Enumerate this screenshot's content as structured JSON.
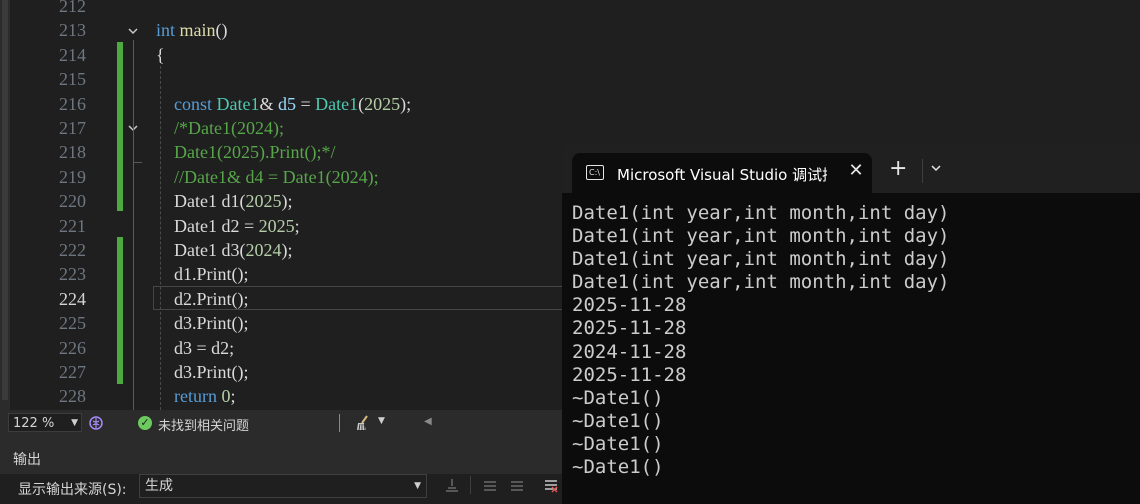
{
  "editor": {
    "lines": [
      {
        "n": "212",
        "current": false,
        "segments": []
      },
      {
        "n": "213",
        "current": false,
        "segments": [
          {
            "t": "int ",
            "c": "kw"
          },
          {
            "t": "main",
            "c": "fn"
          },
          {
            "t": "()",
            "c": "pl"
          }
        ]
      },
      {
        "n": "214",
        "current": false,
        "segments": [
          {
            "t": "{",
            "c": "pl"
          }
        ]
      },
      {
        "n": "215",
        "current": false,
        "segments": []
      },
      {
        "n": "216",
        "current": false,
        "segments": [
          {
            "t": "    "
          },
          {
            "t": "const ",
            "c": "kw"
          },
          {
            "t": "Date1",
            "c": "ty"
          },
          {
            "t": "& ",
            "c": "pl"
          },
          {
            "t": "d5",
            "c": "var"
          },
          {
            "t": " = ",
            "c": "pl"
          },
          {
            "t": "Date1",
            "c": "ty"
          },
          {
            "t": "(",
            "c": "pl"
          },
          {
            "t": "2025",
            "c": "num"
          },
          {
            "t": ");",
            "c": "pl"
          }
        ]
      },
      {
        "n": "217",
        "current": false,
        "segments": [
          {
            "t": "    "
          },
          {
            "t": "/*Date1(2024);",
            "c": "cm"
          }
        ]
      },
      {
        "n": "218",
        "current": false,
        "segments": [
          {
            "t": "    "
          },
          {
            "t": "Date1(2025).Print();*/",
            "c": "cm"
          }
        ]
      },
      {
        "n": "219",
        "current": false,
        "segments": [
          {
            "t": "    "
          },
          {
            "t": "//Date1& d4 = Date1(2024);",
            "c": "cm"
          }
        ]
      },
      {
        "n": "220",
        "current": false,
        "segments": [
          {
            "t": "    "
          },
          {
            "t": "Date1",
            "c": "pl"
          },
          {
            "t": " d1(",
            "c": "pl"
          },
          {
            "t": "2025",
            "c": "num"
          },
          {
            "t": ");",
            "c": "pl"
          }
        ]
      },
      {
        "n": "221",
        "current": false,
        "segments": [
          {
            "t": "    "
          },
          {
            "t": "Date1",
            "c": "pl"
          },
          {
            "t": " d2 = ",
            "c": "pl"
          },
          {
            "t": "2025",
            "c": "num"
          },
          {
            "t": ";",
            "c": "pl"
          }
        ]
      },
      {
        "n": "222",
        "current": false,
        "segments": [
          {
            "t": "    "
          },
          {
            "t": "Date1",
            "c": "pl"
          },
          {
            "t": " d3(",
            "c": "pl"
          },
          {
            "t": "2024",
            "c": "num"
          },
          {
            "t": ");",
            "c": "pl"
          }
        ]
      },
      {
        "n": "223",
        "current": false,
        "segments": [
          {
            "t": "    "
          },
          {
            "t": "d1.",
            "c": "pl"
          },
          {
            "t": "Print",
            "c": "pl"
          },
          {
            "t": "();",
            "c": "pl"
          }
        ]
      },
      {
        "n": "224",
        "current": true,
        "segments": [
          {
            "t": "    "
          },
          {
            "t": "d2.",
            "c": "pl"
          },
          {
            "t": "Print",
            "c": "pl"
          },
          {
            "t": "();",
            "c": "pl"
          }
        ]
      },
      {
        "n": "225",
        "current": false,
        "segments": [
          {
            "t": "    "
          },
          {
            "t": "d3.",
            "c": "pl"
          },
          {
            "t": "Print",
            "c": "pl"
          },
          {
            "t": "();",
            "c": "pl"
          }
        ]
      },
      {
        "n": "226",
        "current": false,
        "segments": [
          {
            "t": "    "
          },
          {
            "t": "d3 = d2;",
            "c": "pl"
          }
        ]
      },
      {
        "n": "227",
        "current": false,
        "segments": [
          {
            "t": "    "
          },
          {
            "t": "d3.",
            "c": "pl"
          },
          {
            "t": "Print",
            "c": "pl"
          },
          {
            "t": "();",
            "c": "pl"
          }
        ]
      },
      {
        "n": "228",
        "current": false,
        "segments": [
          {
            "t": "    "
          },
          {
            "t": "return ",
            "c": "kw"
          },
          {
            "t": "0",
            "c": "num"
          },
          {
            "t": ";",
            "c": "pl"
          }
        ]
      }
    ]
  },
  "status": {
    "zoom": "122 %",
    "issues": "未找到相关问题"
  },
  "output": {
    "title": "输出",
    "source_label": "显示输出来源(S):",
    "source_value": "生成"
  },
  "console": {
    "title": "Microsoft Visual Studio 调试控",
    "lines": [
      "Date1(int year,int month,int day)",
      "Date1(int year,int month,int day)",
      "Date1(int year,int month,int day)",
      "Date1(int year,int month,int day)",
      "2025-11-28",
      "2025-11-28",
      "2024-11-28",
      "2025-11-28",
      "~Date1()",
      "~Date1()",
      "~Date1()",
      "~Date1()"
    ]
  },
  "colors": {
    "accent_green": "#4ea940",
    "keyword": "#569cd6",
    "type": "#4ec9b0",
    "comment": "#57a64a",
    "number": "#b5cea8"
  }
}
